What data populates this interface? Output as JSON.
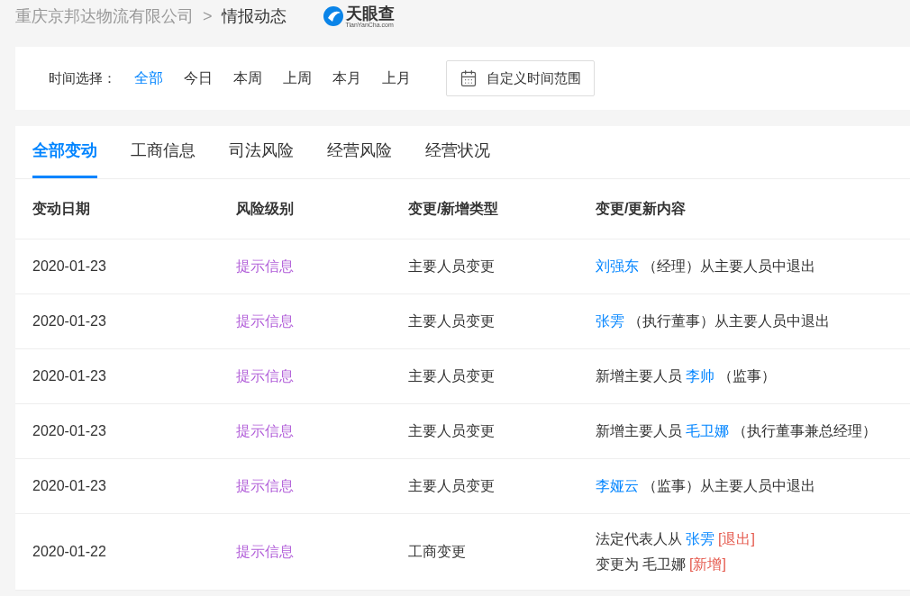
{
  "breadcrumb": {
    "company": "重庆京邦达物流有限公司",
    "separator": ">",
    "current": "情报动态"
  },
  "logo": {
    "name": "天眼查",
    "domain": "TianYanCha.com"
  },
  "time_filter": {
    "label": "时间选择：",
    "options": [
      {
        "label": "全部",
        "selected": true
      },
      {
        "label": "今日",
        "selected": false
      },
      {
        "label": "本周",
        "selected": false
      },
      {
        "label": "上周",
        "selected": false
      },
      {
        "label": "本月",
        "selected": false
      },
      {
        "label": "上月",
        "selected": false
      }
    ],
    "custom_button": "自定义时间范围"
  },
  "tabs": [
    {
      "label": "全部变动",
      "selected": true
    },
    {
      "label": "工商信息",
      "selected": false
    },
    {
      "label": "司法风险",
      "selected": false
    },
    {
      "label": "经营风险",
      "selected": false
    },
    {
      "label": "经营状况",
      "selected": false
    }
  ],
  "table": {
    "columns": [
      "变动日期",
      "风险级别",
      "变更/新增类型",
      "变更/更新内容"
    ],
    "rows": [
      {
        "date": "2020-01-23",
        "risk": "提示信息",
        "type": "主要人员变更",
        "content": [
          [
            {
              "kind": "person",
              "text": "刘强东"
            },
            {
              "kind": "text",
              "text": "（经理）从主要人员中退出"
            }
          ]
        ]
      },
      {
        "date": "2020-01-23",
        "risk": "提示信息",
        "type": "主要人员变更",
        "content": [
          [
            {
              "kind": "person",
              "text": "张雱"
            },
            {
              "kind": "text",
              "text": "（执行董事）从主要人员中退出"
            }
          ]
        ]
      },
      {
        "date": "2020-01-23",
        "risk": "提示信息",
        "type": "主要人员变更",
        "content": [
          [
            {
              "kind": "text",
              "text": "新增主要人员"
            },
            {
              "kind": "person",
              "text": "李帅"
            },
            {
              "kind": "text",
              "text": "（监事）"
            }
          ]
        ]
      },
      {
        "date": "2020-01-23",
        "risk": "提示信息",
        "type": "主要人员变更",
        "content": [
          [
            {
              "kind": "text",
              "text": "新增主要人员"
            },
            {
              "kind": "person",
              "text": "毛卫娜"
            },
            {
              "kind": "text",
              "text": "（执行董事兼总经理）"
            }
          ]
        ]
      },
      {
        "date": "2020-01-23",
        "risk": "提示信息",
        "type": "主要人员变更",
        "content": [
          [
            {
              "kind": "person",
              "text": "李娅云"
            },
            {
              "kind": "text",
              "text": "（监事）从主要人员中退出"
            }
          ]
        ]
      },
      {
        "date": "2020-01-22",
        "risk": "提示信息",
        "type": "工商变更",
        "content": [
          [
            {
              "kind": "text",
              "text": "法定代表人从"
            },
            {
              "kind": "person",
              "text": "张雱"
            },
            {
              "kind": "tag",
              "text": "[退出]"
            }
          ],
          [
            {
              "kind": "text",
              "text": "变更为"
            },
            {
              "kind": "text",
              "text": "毛卫娜"
            },
            {
              "kind": "tag",
              "text": "[新增]"
            }
          ]
        ]
      }
    ]
  }
}
